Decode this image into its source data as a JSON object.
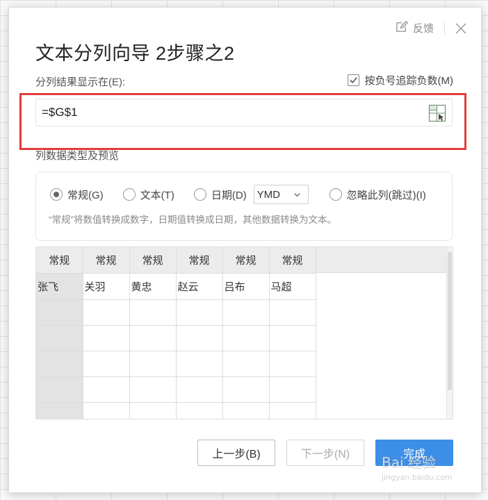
{
  "dialog": {
    "title": "文本分列向导 2步骤之2",
    "feedback_label": "反馈"
  },
  "destination": {
    "label": "分列结果显示在(E):",
    "value": "=$G$1",
    "negative_label": "按负号追踪负数(M)",
    "negative_checked": true
  },
  "column_type": {
    "label": "列数据类型及预览",
    "options": [
      {
        "label": "常规(G)",
        "selected": true
      },
      {
        "label": "文本(T)",
        "selected": false
      },
      {
        "label": "日期(D)",
        "selected": false
      },
      {
        "label": "忽略此列(跳过)(I)",
        "selected": false
      }
    ],
    "date_format": "YMD",
    "hint": "“常规”将数值转换成数字，日期值转换成日期，其他数据转换为文本。"
  },
  "preview": {
    "headers": [
      "常规",
      "常规",
      "常规",
      "常规",
      "常规",
      "常规"
    ],
    "rows": [
      [
        "张飞",
        "关羽",
        "黄忠",
        "赵云",
        "吕布",
        "马超"
      ],
      [
        "",
        "",
        "",
        "",
        "",
        ""
      ],
      [
        "",
        "",
        "",
        "",
        "",
        ""
      ],
      [
        "",
        "",
        "",
        "",
        "",
        ""
      ],
      [
        "",
        "",
        "",
        "",
        "",
        ""
      ],
      [
        "",
        "",
        "",
        "",
        "",
        ""
      ]
    ]
  },
  "buttons": {
    "prev": "上一步(B)",
    "next": "下一步(N)",
    "finish": "完成"
  },
  "watermark": {
    "text": "Bai 经验",
    "url": "jingyan.baidu.com"
  },
  "colors": {
    "highlight": "#e23b3b",
    "primary": "#3d8ee6"
  }
}
